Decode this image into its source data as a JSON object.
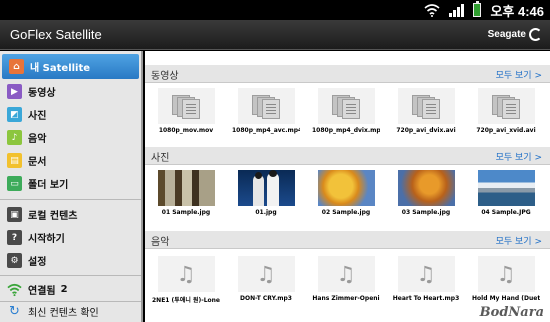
{
  "status_bar": {
    "time": "오후 4:46",
    "icons": [
      "wifi-icon",
      "signal-icon",
      "battery-icon"
    ]
  },
  "app": {
    "title": "GoFlex Satellite",
    "brand": "Seagate"
  },
  "sidebar": {
    "items": [
      {
        "label": "내 Satellite",
        "icon": "home-icon",
        "active": true
      },
      {
        "label": "동영상",
        "icon": "video-icon"
      },
      {
        "label": "사진",
        "icon": "photo-icon"
      },
      {
        "label": "음악",
        "icon": "music-icon"
      },
      {
        "label": "문서",
        "icon": "document-icon"
      },
      {
        "label": "폴더 보기",
        "icon": "folder-icon"
      },
      {
        "label": "로컬 컨텐츠",
        "icon": "local-content-icon"
      },
      {
        "label": "시작하기",
        "icon": "help-icon"
      },
      {
        "label": "설정",
        "icon": "gear-icon"
      }
    ],
    "connection": {
      "label": "연결됨",
      "count": "2",
      "icon": "wifi-icon"
    },
    "refresh": {
      "label": "최신 컨텐츠 확인",
      "icon": "refresh-icon"
    }
  },
  "sections": {
    "videos": {
      "title": "동영상",
      "view_all": "모두 보기 >",
      "items": [
        "1080p_mov.mov",
        "1080p_mp4_avc.mp4",
        "1080p_mp4_dvix.mp4",
        "720p_avi_dvix.avi",
        "720p_avi_xvid.avi"
      ]
    },
    "photos": {
      "title": "사진",
      "view_all": "모두 보기 >",
      "items": [
        "01 Sample.jpg",
        "01.jpg",
        "02 Sample.jpg",
        "03 Sample.jpg",
        "04 Sample.JPG"
      ]
    },
    "music": {
      "title": "음악",
      "view_all": "모두 보기 >",
      "items": [
        "2NE1 (투애니 원)-Lone",
        "DON-T CRY.mp3",
        "Hans Zimmer-Openi",
        "Heart To Heart.mp3",
        "Hold My Hand (Duet"
      ]
    }
  },
  "watermark": "BodNara"
}
